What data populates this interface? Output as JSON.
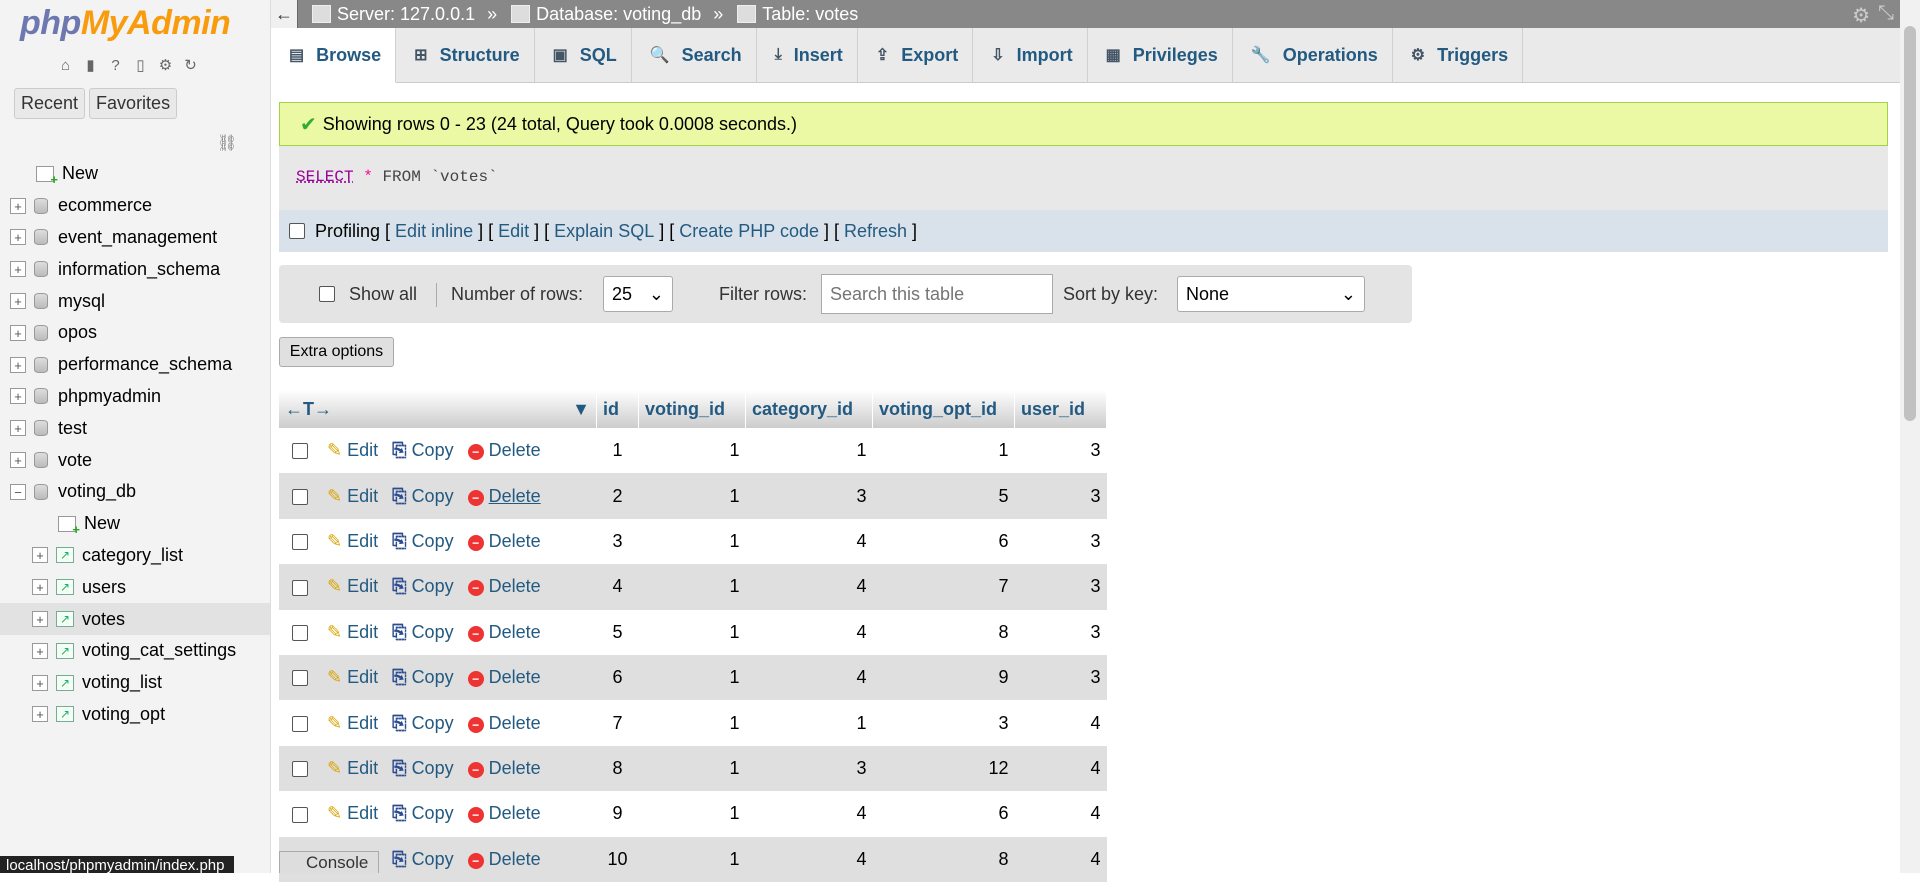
{
  "sidebar": {
    "logo_php": "php",
    "logo_my": "MyAdmin",
    "tabs": {
      "recent": "Recent",
      "favorites": "Favorites"
    },
    "tree": [
      {
        "label": "New",
        "type": "new",
        "level": 0
      },
      {
        "label": "ecommerce",
        "type": "db",
        "level": 0
      },
      {
        "label": "event_management",
        "type": "db",
        "level": 0
      },
      {
        "label": "information_schema",
        "type": "db",
        "level": 0
      },
      {
        "label": "mysql",
        "type": "db",
        "level": 0
      },
      {
        "label": "opos",
        "type": "db",
        "level": 0
      },
      {
        "label": "performance_schema",
        "type": "db",
        "level": 0
      },
      {
        "label": "phpmyadmin",
        "type": "db",
        "level": 0
      },
      {
        "label": "test",
        "type": "db",
        "level": 0
      },
      {
        "label": "vote",
        "type": "db",
        "level": 0
      },
      {
        "label": "voting_db",
        "type": "db",
        "level": 0,
        "expanded": true
      },
      {
        "label": "New",
        "type": "new",
        "level": 1
      },
      {
        "label": "category_list",
        "type": "table",
        "level": 1
      },
      {
        "label": "users",
        "type": "table",
        "level": 1
      },
      {
        "label": "votes",
        "type": "table",
        "level": 1,
        "selected": true
      },
      {
        "label": "voting_cat_settings",
        "type": "table",
        "level": 1
      },
      {
        "label": "voting_list",
        "type": "table",
        "level": 1
      },
      {
        "label": "voting_opt",
        "type": "table",
        "level": 1
      }
    ]
  },
  "status_bar": "localhost/phpmyadmin/index.php",
  "breadcrumb": {
    "back": "←",
    "server": "Server: 127.0.0.1",
    "database": "Database: voting_db",
    "table": "Table: votes",
    "separator": "»"
  },
  "tabs": [
    {
      "label": "Browse",
      "icon": "browse-icon",
      "active": true
    },
    {
      "label": "Structure",
      "icon": "structure-icon"
    },
    {
      "label": "SQL",
      "icon": "sql-icon"
    },
    {
      "label": "Search",
      "icon": "search-icon"
    },
    {
      "label": "Insert",
      "icon": "insert-icon"
    },
    {
      "label": "Export",
      "icon": "export-icon"
    },
    {
      "label": "Import",
      "icon": "import-icon"
    },
    {
      "label": "Privileges",
      "icon": "privileges-icon"
    },
    {
      "label": "Operations",
      "icon": "operations-icon"
    },
    {
      "label": "Triggers",
      "icon": "triggers-icon"
    }
  ],
  "message": "Showing rows 0 - 23 (24 total, Query took 0.0008 seconds.)",
  "sql": {
    "select": "SELECT",
    "star": "*",
    "rest": "FROM `votes`"
  },
  "profiling": {
    "label": "Profiling",
    "open": "[",
    "close": "]",
    "divider": "] [",
    "links": [
      "Edit inline",
      "Edit",
      "Explain SQL",
      "Create PHP code",
      "Refresh"
    ]
  },
  "controls": {
    "show_all": "Show all",
    "num_rows_label": "Number of rows:",
    "num_rows_value": "25",
    "filter_label": "Filter rows:",
    "filter_placeholder": "Search this table",
    "sort_label": "Sort by key:",
    "sort_value": "None"
  },
  "extra_options": "Extra options",
  "table": {
    "nav_arrows": "←T→",
    "columns": [
      "id",
      "voting_id",
      "category_id",
      "voting_opt_id",
      "user_id"
    ],
    "actions": {
      "edit": "Edit",
      "copy": "Copy",
      "delete": "Delete"
    },
    "rows": [
      [
        1,
        1,
        1,
        1,
        3
      ],
      [
        2,
        1,
        3,
        5,
        3
      ],
      [
        3,
        1,
        4,
        6,
        3
      ],
      [
        4,
        1,
        4,
        7,
        3
      ],
      [
        5,
        1,
        4,
        8,
        3
      ],
      [
        6,
        1,
        4,
        9,
        3
      ],
      [
        7,
        1,
        1,
        3,
        4
      ],
      [
        8,
        1,
        3,
        12,
        4
      ],
      [
        9,
        1,
        4,
        6,
        4
      ],
      [
        10,
        1,
        4,
        8,
        4
      ]
    ]
  },
  "console": "Console"
}
